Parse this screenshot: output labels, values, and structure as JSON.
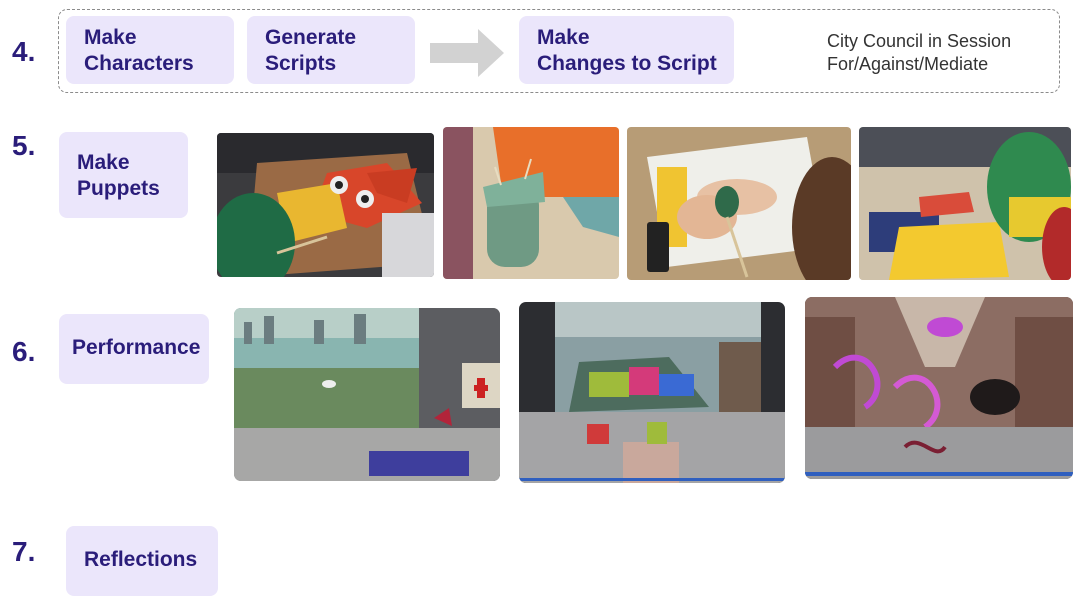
{
  "step4": {
    "number": "4.",
    "box1": {
      "line1": "Make",
      "line2": "Characters"
    },
    "box2": {
      "line1": "Generate",
      "line2": "Scripts"
    },
    "box3": {
      "line1": "Make",
      "line2": "Changes to Script"
    },
    "note": {
      "line1": "City Council in Session",
      "line2": "For/Against/Mediate"
    }
  },
  "step5": {
    "number": "5.",
    "box": {
      "line1": "Make",
      "line2": "Puppets"
    }
  },
  "step6": {
    "number": "6.",
    "box": {
      "line1": "Performance"
    }
  },
  "step7": {
    "number": "7.",
    "box": {
      "line1": "Reflections"
    }
  },
  "colors": {
    "accent": "#2a1d7a",
    "box_fill": "#ebe6fb",
    "arrow": "#d2d2d2"
  },
  "icons": [
    "arrow-right-icon"
  ]
}
